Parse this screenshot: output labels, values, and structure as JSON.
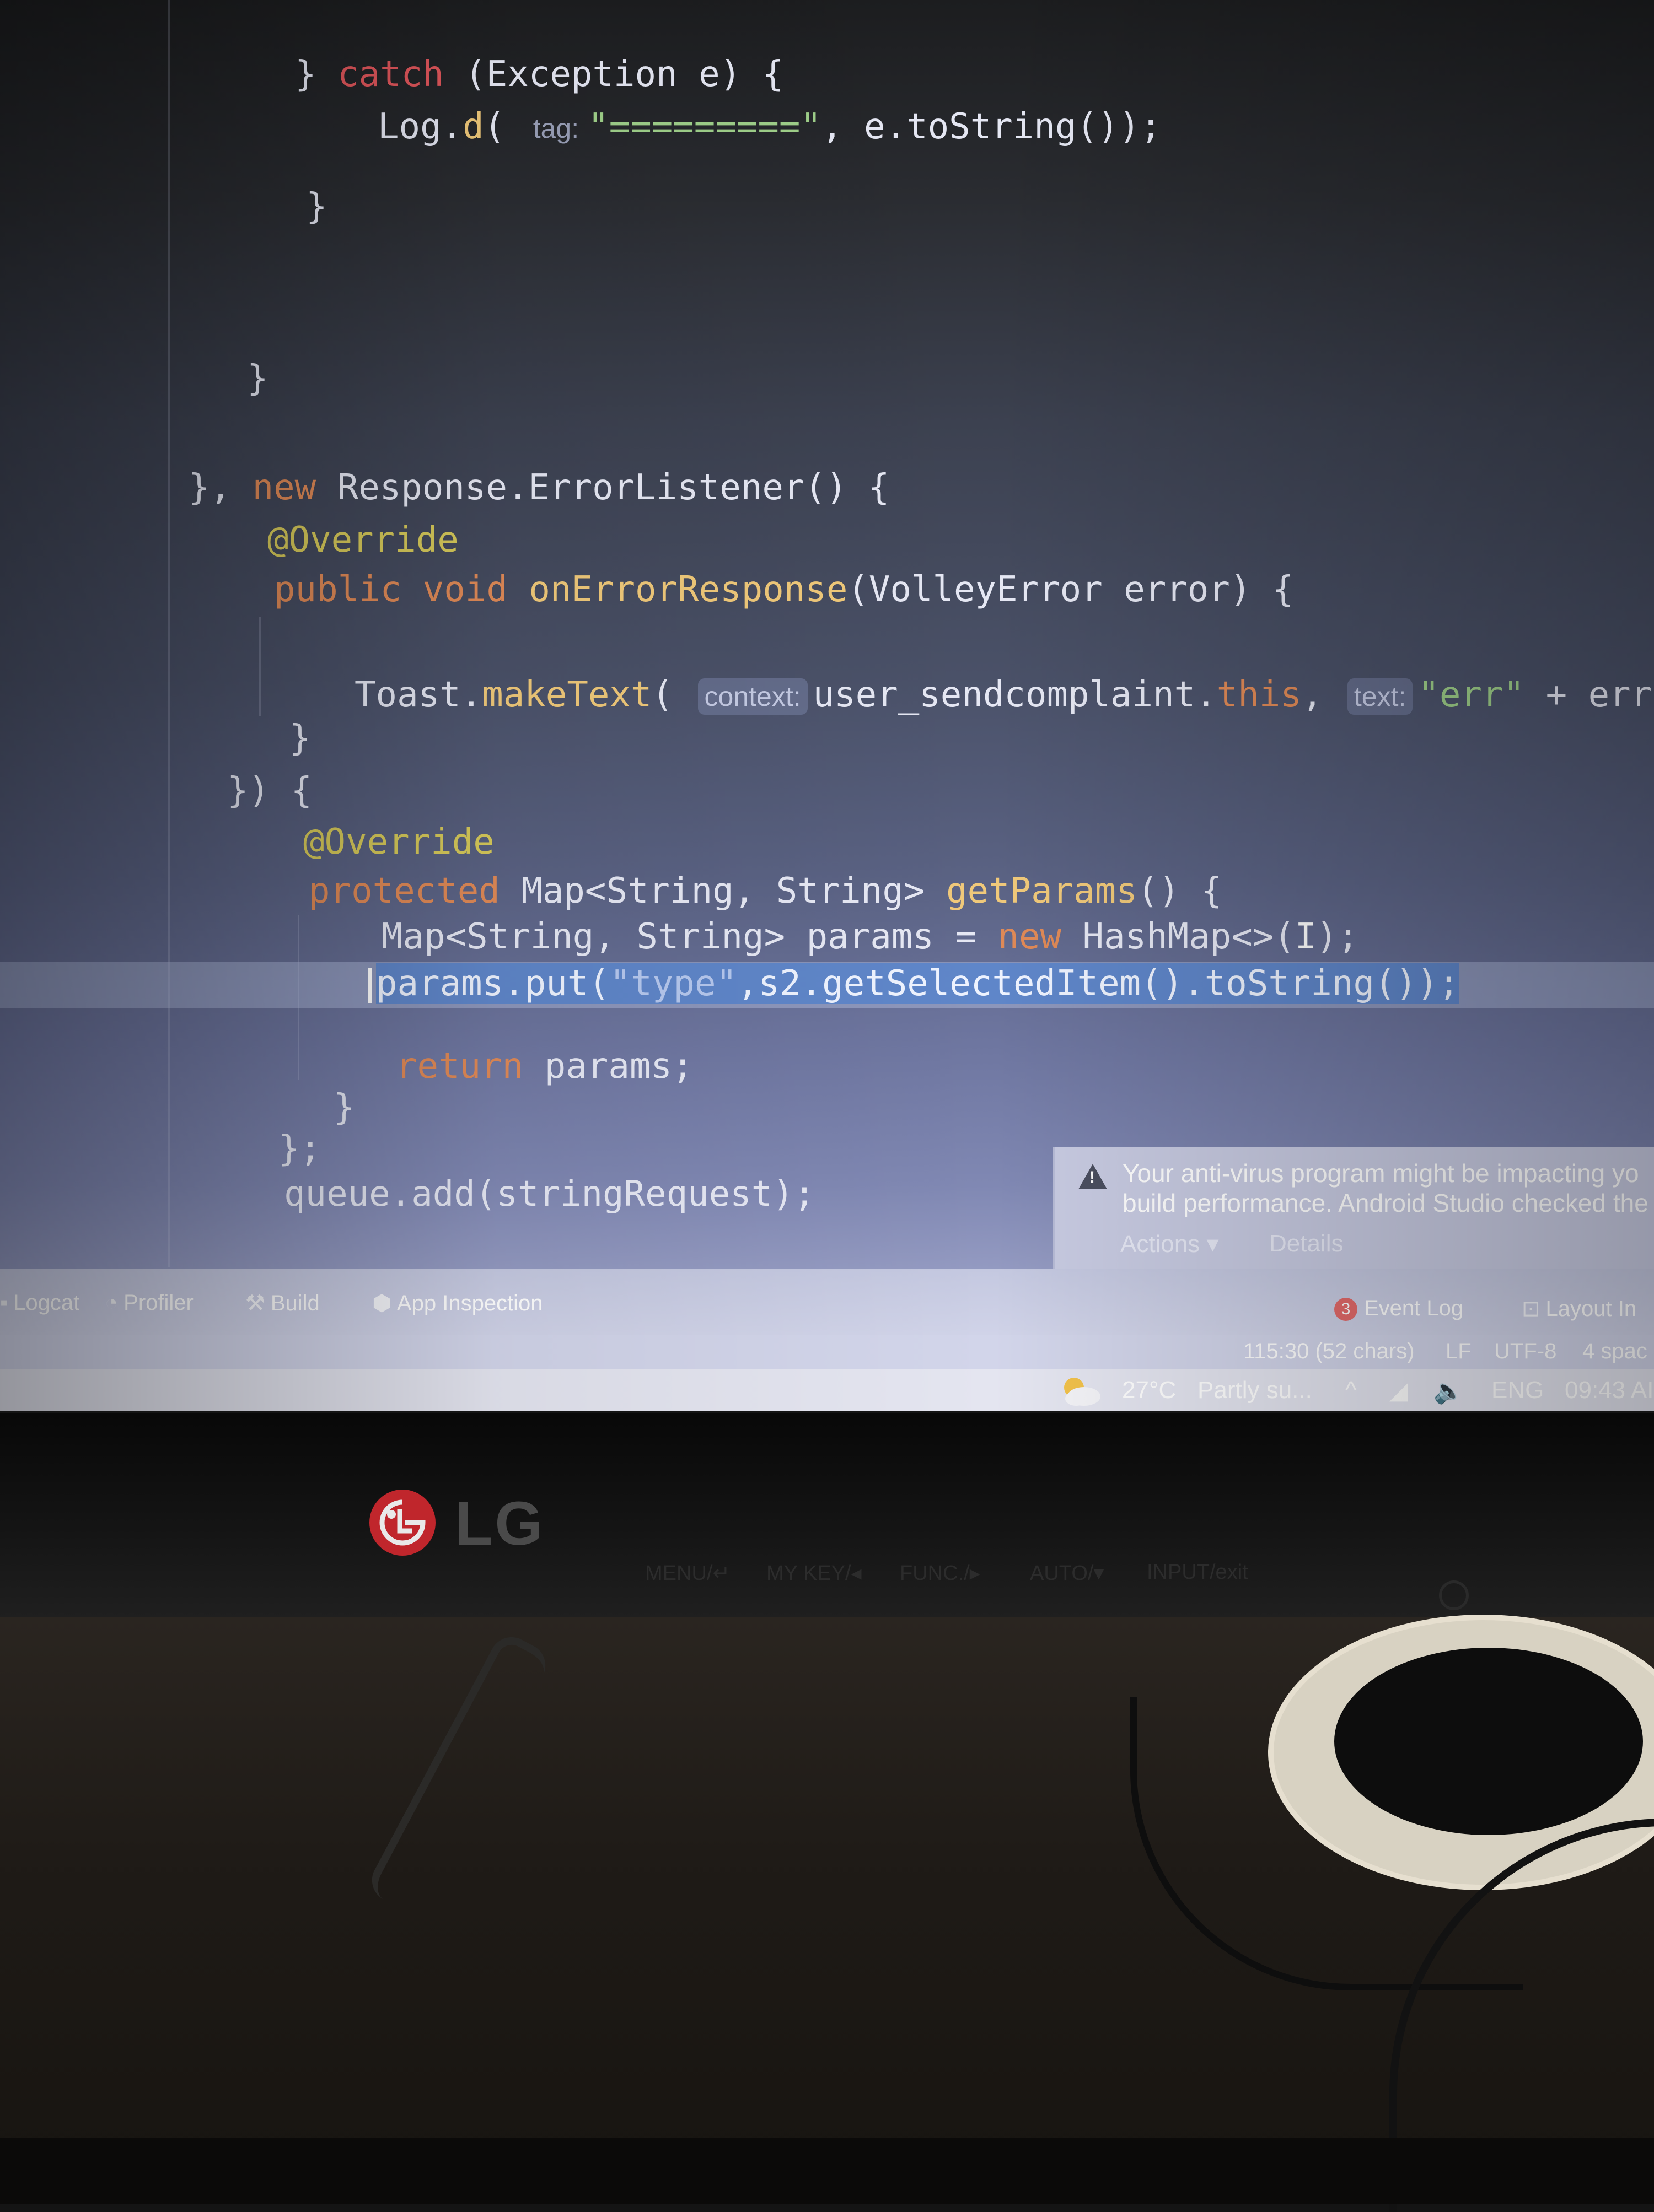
{
  "code_lines": [
    {
      "id": "l1",
      "parts": [
        {
          "t": "} ",
          "c": "plain"
        },
        {
          "t": "catch",
          "c": "kw-red"
        },
        {
          "t": " (Exception e) {",
          "c": "plain"
        }
      ]
    },
    {
      "id": "l2",
      "parts": [
        {
          "t": "Log.",
          "c": "plain"
        },
        {
          "t": "d",
          "c": "fn"
        },
        {
          "t": "( ",
          "c": "plain"
        },
        {
          "hint": "tag:",
          "style": "hint-tag"
        },
        {
          "t": "\"=========\"",
          "c": "str"
        },
        {
          "t": ", e.toString());",
          "c": "plain"
        }
      ]
    },
    {
      "id": "l3",
      "parts": [
        {
          "t": "}",
          "c": "plain"
        }
      ]
    },
    {
      "id": "l4",
      "parts": [
        {
          "t": "}",
          "c": "plain"
        }
      ]
    },
    {
      "id": "l5",
      "parts": [
        {
          "t": "}, ",
          "c": "plain"
        },
        {
          "t": "new",
          "c": "kw"
        },
        {
          "t": " Response.ErrorListener() {",
          "c": "plain"
        }
      ]
    },
    {
      "id": "l6",
      "parts": [
        {
          "t": "@Override",
          "c": "ann"
        }
      ]
    },
    {
      "id": "l7",
      "parts": [
        {
          "t": "public void ",
          "c": "kw"
        },
        {
          "t": "onErrorResponse",
          "c": "fn"
        },
        {
          "t": "(VolleyError error) {",
          "c": "plain"
        }
      ]
    },
    {
      "id": "l8",
      "parts": [
        {
          "t": "Toast.",
          "c": "plain"
        },
        {
          "t": "makeText",
          "c": "fn"
        },
        {
          "t": "( ",
          "c": "plain"
        },
        {
          "hint": "context:"
        },
        {
          "t": "user_sendcomplaint.",
          "c": "plain"
        },
        {
          "t": "this",
          "c": "kw"
        },
        {
          "t": ", ",
          "c": "plain"
        },
        {
          "hint": "text:"
        },
        {
          "t": "\"err\"",
          "c": "str"
        },
        {
          "t": " + error, Toas",
          "c": "plain"
        }
      ]
    },
    {
      "id": "l9",
      "parts": [
        {
          "t": "}",
          "c": "plain"
        }
      ]
    },
    {
      "id": "l10",
      "parts": [
        {
          "t": "}) {",
          "c": "plain"
        }
      ]
    },
    {
      "id": "l11",
      "parts": [
        {
          "t": "@Override",
          "c": "ann"
        }
      ]
    },
    {
      "id": "l12",
      "parts": [
        {
          "t": "protected ",
          "c": "kw"
        },
        {
          "t": "Map<String, String> ",
          "c": "plain"
        },
        {
          "t": "getParams",
          "c": "fn"
        },
        {
          "t": "() {",
          "c": "plain"
        }
      ]
    },
    {
      "id": "l13",
      "parts": [
        {
          "t": "Map<String, String> params = ",
          "c": "plain"
        },
        {
          "t": "new",
          "c": "kw"
        },
        {
          "t": " HashMap<>(",
          "c": "plain"
        },
        {
          "t": "I",
          "c": "ibeam"
        },
        {
          "t": ");",
          "c": "plain"
        }
      ]
    },
    {
      "id": "l14",
      "selected": true,
      "parts": [
        {
          "t": "params.put(",
          "c": "plain"
        },
        {
          "t": "\"type\"",
          "c": "str"
        },
        {
          "t": ",s2.getSelectedItem().toString());",
          "c": "plain"
        }
      ]
    },
    {
      "id": "l15",
      "parts": [
        {
          "t": "return",
          "c": "kw"
        },
        {
          "t": " params;",
          "c": "plain"
        }
      ]
    },
    {
      "id": "l16",
      "parts": [
        {
          "t": "}",
          "c": "plain"
        }
      ]
    },
    {
      "id": "l17",
      "parts": [
        {
          "t": "};",
          "c": "plain"
        }
      ]
    },
    {
      "id": "l18",
      "parts": [
        {
          "t": "queue.add(stringRequest);",
          "c": "plain"
        }
      ]
    }
  ],
  "notification": {
    "line1": "Your anti-virus program might be impacting yo",
    "line2": "build performance. Android Studio checked the",
    "actions_label": "Actions ▾",
    "details_label": "Details"
  },
  "tool_windows": {
    "logcat": "Logcat",
    "profiler": "Profiler",
    "build": "Build",
    "app_inspection": "App Inspection",
    "event_log_count": "3",
    "event_log": "Event Log",
    "layout_inspector": "Layout In"
  },
  "status_bar": {
    "position": "115:30 (52 chars)",
    "line_sep": "LF",
    "encoding": "UTF-8",
    "indent": "4 spac"
  },
  "taskbar": {
    "temperature": "27°C",
    "weather": "Partly su...",
    "language": "ENG",
    "time": "09:43 AI"
  },
  "monitor": {
    "brand": "LG",
    "buttons": [
      "MENU/↵",
      "MY KEY/◂",
      "FUNC./▸",
      "AUTO/▾",
      "INPUT/exit"
    ]
  },
  "icons": {
    "warning": "warning-icon",
    "weather": "partly-sunny-icon",
    "power": "power-icon",
    "logo": "lg-logo-icon"
  },
  "colors": {
    "keyword": "#e08a57",
    "annotation": "#d6c95a",
    "string": "#9fd08a",
    "selection": "#5f86c9",
    "lg_red": "#c0262c"
  }
}
